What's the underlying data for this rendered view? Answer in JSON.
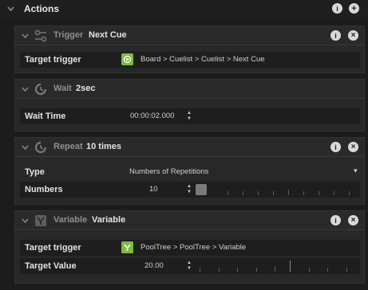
{
  "section": {
    "title": "Actions"
  },
  "trigger_block": {
    "type": "Trigger",
    "name": "Next Cue",
    "row_label": "Target trigger",
    "path": "Board > Cuelist > Cuelist > Next Cue"
  },
  "wait_block": {
    "type": "Wait",
    "name": "2sec",
    "row_label": "Wait Time",
    "value": "00:00:02.000"
  },
  "repeat_block": {
    "type": "Repeat",
    "name": "10 times",
    "type_label": "Type",
    "type_value": "Numbers of Repetitions",
    "numbers_label": "Numbers",
    "numbers_value": "10"
  },
  "variable_block": {
    "type": "Variable",
    "name": "Variable",
    "target_label": "Target trigger",
    "path": "PoolTree > PoolTree > Variable",
    "value_label": "Target Value",
    "value": "20.00"
  },
  "icons": {
    "info": "info-icon",
    "close": "close-icon",
    "add": "add-icon",
    "collapse": "chevron-down-icon",
    "dropdown": "dropdown-arrow-icon"
  },
  "colors": {
    "accent_green": "#7dbd3a",
    "background": "#1c1c1c",
    "panel": "#282828"
  },
  "glyphs": {
    "info": "i",
    "close": "×",
    "add": "+",
    "dropdown": "▾"
  }
}
